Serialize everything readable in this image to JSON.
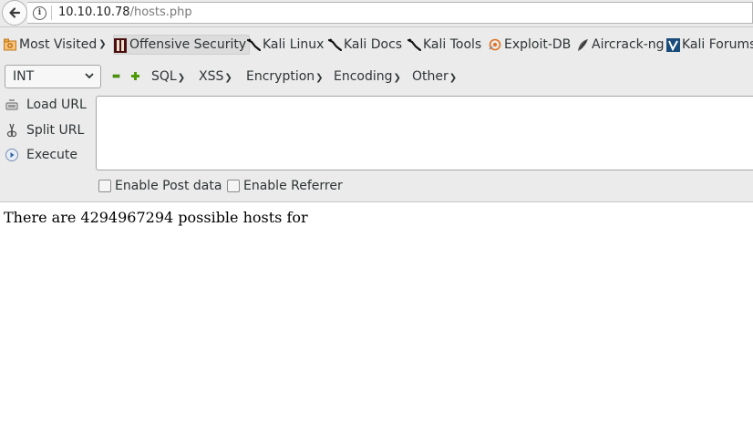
{
  "urlbar": {
    "host": "10.10.10.78",
    "path": "/hosts.php"
  },
  "bookmarks": {
    "most_visited": "Most Visited",
    "items": [
      {
        "label": "Offensive Security",
        "icon": "offsec-icon"
      },
      {
        "label": "Kali Linux",
        "icon": "kali-dragon-icon"
      },
      {
        "label": "Kali Docs",
        "icon": "kali-dragon-icon"
      },
      {
        "label": "Kali Tools",
        "icon": "kali-dragon-icon"
      },
      {
        "label": "Exploit-DB",
        "icon": "exploit-db-icon"
      },
      {
        "label": "Aircrack-ng",
        "icon": "aircrack-icon"
      },
      {
        "label": "Kali Forums",
        "icon": "kali-forums-icon"
      }
    ]
  },
  "hackbar": {
    "select_value": "INT",
    "minus": "−",
    "plus": "+",
    "menus": [
      "SQL",
      "XSS",
      "Encryption",
      "Encoding",
      "Other"
    ],
    "load_url": "Load URL",
    "split_url": "Split URL",
    "execute": "Execute",
    "enable_post": "Enable Post data",
    "enable_referrer": "Enable Referrer"
  },
  "page": {
    "text": "There are 4294967294 possible hosts for"
  }
}
